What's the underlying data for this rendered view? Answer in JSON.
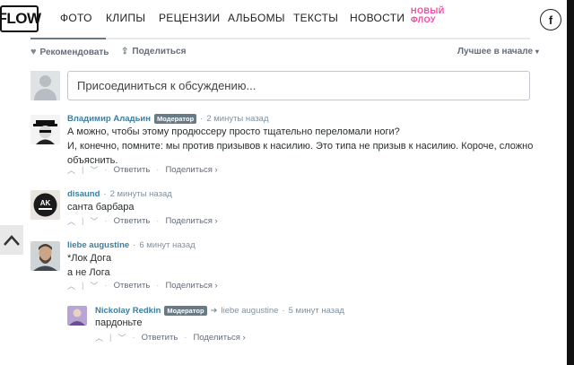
{
  "header": {
    "logo": "FLOW",
    "nav": [
      "ФОТО",
      "КЛИПЫ",
      "РЕЦЕНЗИИ",
      "АЛЬБОМЫ",
      "ТЕКСТЫ",
      "НОВОСТИ"
    ],
    "new_flow_line1": "НОВЫЙ",
    "new_flow_line2": "ФЛОУ",
    "facebook_glyph": "f"
  },
  "disqus": {
    "recommend_label": "Рекомендовать",
    "share_label": "Поделиться",
    "sort_label": "Лучшее в начале",
    "join_placeholder": "Присоединиться к обсуждению...",
    "moderator_badge": "Модератор",
    "reply_label": "Ответить",
    "share_action": "Поделиться ›",
    "comments": [
      {
        "author": "Владимир Аладьин",
        "time": "2 минуты назад",
        "lines": [
          "А можно, чтобы этому продюссеру просто тщательно переломали ноги?",
          "И, конечно, помните: мы против призывов к насилию. Это типа не призыв к насилию. Короче, сложно",
          "объяснить."
        ]
      },
      {
        "author": "disaund",
        "time": "2 минуты назад",
        "lines": [
          "санта барбара"
        ]
      },
      {
        "author": "liebe augustine",
        "time": "6 минут назад",
        "lines": [
          "*Лок Дога",
          "а не Лога"
        ]
      },
      {
        "author": "Nickolay Redkin",
        "reply_to": "liebe augustine",
        "time": "5 минут назад",
        "lines": [
          "пардоньте"
        ]
      }
    ]
  },
  "colors": {
    "accent_link": "#3b7ea1",
    "badge_bg": "#687a86",
    "new_flow_pink": "#ff3fa4"
  }
}
